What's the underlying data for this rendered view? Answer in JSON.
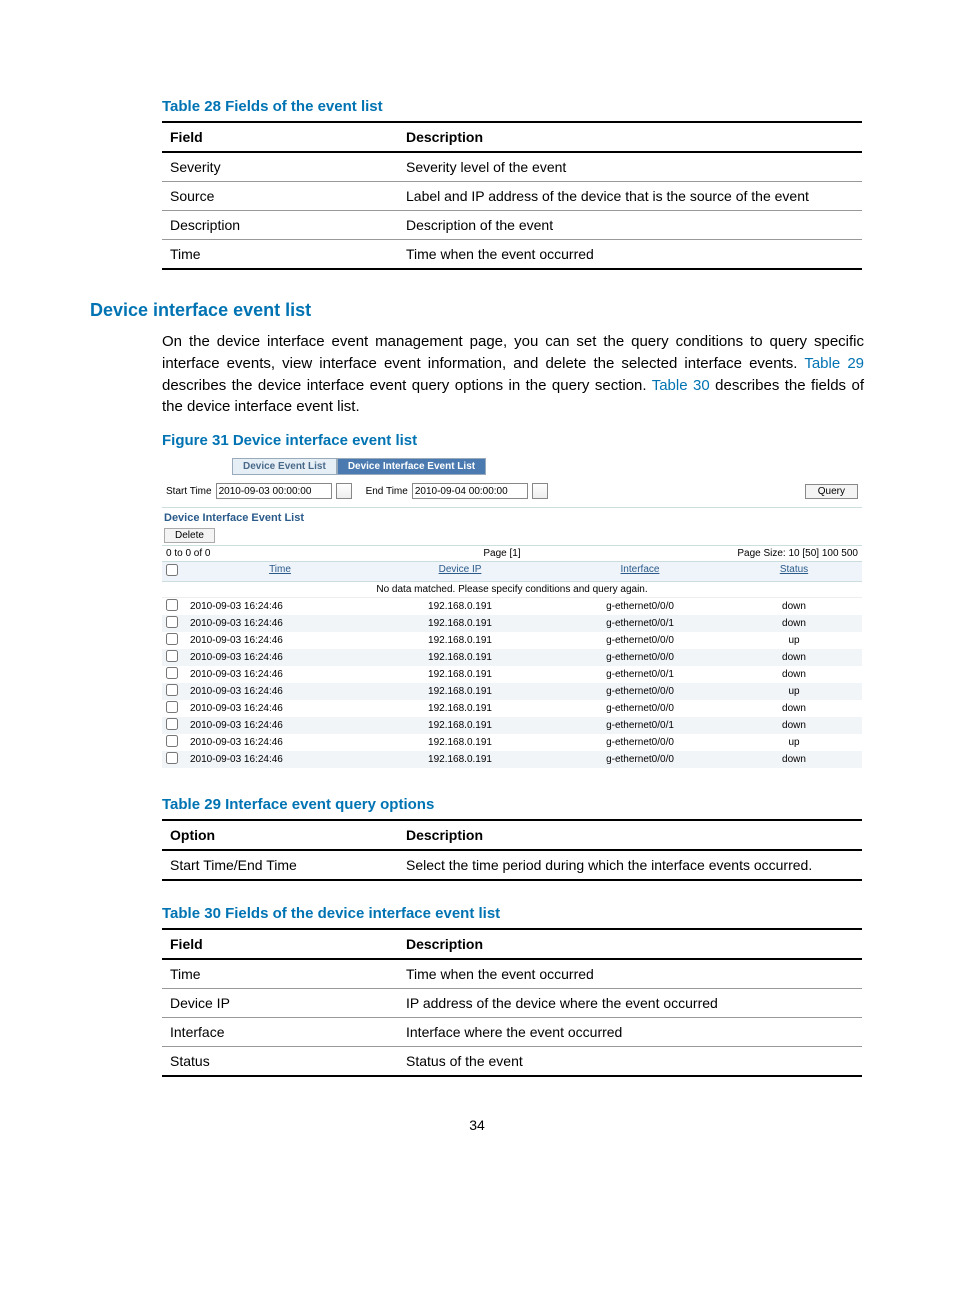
{
  "page_number": "34",
  "table28": {
    "caption": "Table 28 Fields of the event list",
    "head": {
      "c1": "Field",
      "c2": "Description"
    },
    "rows": [
      {
        "c1": "Severity",
        "c2": "Severity level of the event"
      },
      {
        "c1": "Source",
        "c2": "Label and IP address of the device that is the source of the event"
      },
      {
        "c1": "Description",
        "c2": "Description of the event"
      },
      {
        "c1": "Time",
        "c2": "Time when the event occurred"
      }
    ]
  },
  "section_heading": "Device interface event list",
  "body_text_parts": {
    "p1": "On the device interface event management page, you can set the query conditions to query specific interface events, view interface event information, and delete the selected interface events. ",
    "ref29": "Table 29",
    "p2": " describes the device interface event query options in the query section. ",
    "ref30": "Table 30",
    "p3": " describes the fields of the device interface event list."
  },
  "figure31_caption": "Figure 31 Device interface event list",
  "screenshot": {
    "tabs": {
      "inactive": "Device Event List",
      "active": "Device Interface Event List"
    },
    "start_label": "Start Time",
    "start_value": "2010-09-03 00:00:00",
    "end_label": "End Time",
    "end_value": "2010-09-04 00:00:00",
    "query_btn": "Query",
    "panel_title": "Device Interface Event List",
    "delete_btn": "Delete",
    "pager_left": "0 to 0 of 0",
    "pager_center": "Page [1]",
    "pager_right": "Page Size: 10 [50] 100 500",
    "grid_head": {
      "time": "Time",
      "ip": "Device IP",
      "iface": "Interface",
      "status": "Status"
    },
    "nodata": "No data matched. Please specify conditions and query again.",
    "rows": [
      {
        "time": "2010-09-03 16:24:46",
        "ip": "192.168.0.191",
        "iface": "g-ethernet0/0/0",
        "status": "down"
      },
      {
        "time": "2010-09-03 16:24:46",
        "ip": "192.168.0.191",
        "iface": "g-ethernet0/0/1",
        "status": "down"
      },
      {
        "time": "2010-09-03 16:24:46",
        "ip": "192.168.0.191",
        "iface": "g-ethernet0/0/0",
        "status": "up"
      },
      {
        "time": "2010-09-03 16:24:46",
        "ip": "192.168.0.191",
        "iface": "g-ethernet0/0/0",
        "status": "down"
      },
      {
        "time": "2010-09-03 16:24:46",
        "ip": "192.168.0.191",
        "iface": "g-ethernet0/0/1",
        "status": "down"
      },
      {
        "time": "2010-09-03 16:24:46",
        "ip": "192.168.0.191",
        "iface": "g-ethernet0/0/0",
        "status": "up"
      },
      {
        "time": "2010-09-03 16:24:46",
        "ip": "192.168.0.191",
        "iface": "g-ethernet0/0/0",
        "status": "down"
      },
      {
        "time": "2010-09-03 16:24:46",
        "ip": "192.168.0.191",
        "iface": "g-ethernet0/0/1",
        "status": "down"
      },
      {
        "time": "2010-09-03 16:24:46",
        "ip": "192.168.0.191",
        "iface": "g-ethernet0/0/0",
        "status": "up"
      },
      {
        "time": "2010-09-03 16:24:46",
        "ip": "192.168.0.191",
        "iface": "g-ethernet0/0/0",
        "status": "down"
      }
    ]
  },
  "table29": {
    "caption": "Table 29 Interface event query options",
    "head": {
      "c1": "Option",
      "c2": "Description"
    },
    "rows": [
      {
        "c1": "Start Time/End Time",
        "c2": "Select the time period during which the interface events occurred."
      }
    ]
  },
  "table30": {
    "caption": "Table 30 Fields of the device interface event list",
    "head": {
      "c1": "Field",
      "c2": "Description"
    },
    "rows": [
      {
        "c1": "Time",
        "c2": "Time when the event occurred"
      },
      {
        "c1": "Device IP",
        "c2": "IP address of the device where the event occurred"
      },
      {
        "c1": "Interface",
        "c2": "Interface where the event occurred"
      },
      {
        "c1": "Status",
        "c2": "Status of the event"
      }
    ]
  }
}
